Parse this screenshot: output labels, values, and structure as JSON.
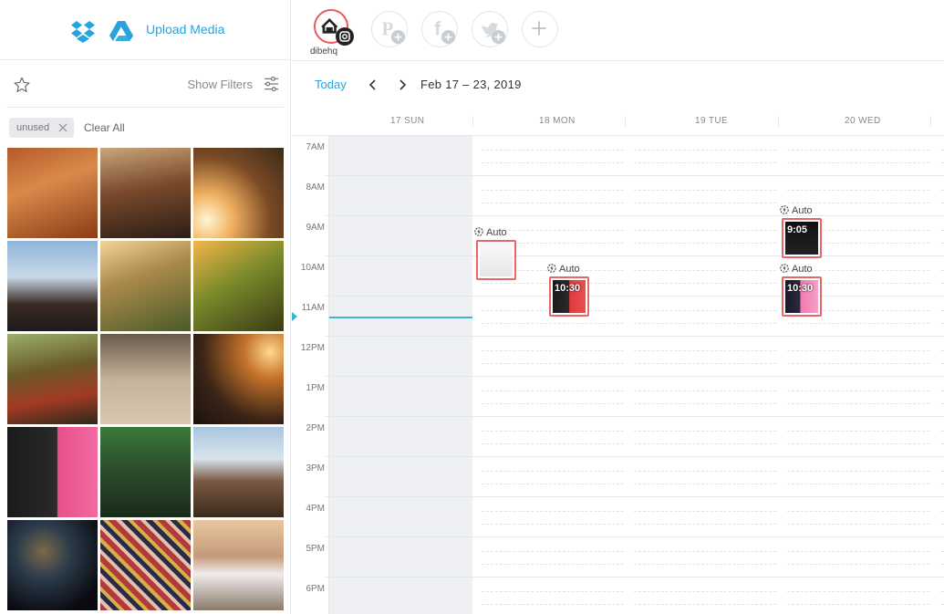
{
  "left_panel": {
    "upload_label": "Upload Media",
    "show_filters_label": "Show Filters",
    "tag_label": "unused",
    "clear_all_label": "Clear All",
    "services": [
      "dropbox-icon",
      "google-drive-icon"
    ],
    "thumbs": [
      {
        "bg": "linear-gradient(160deg,#b45a2a 0%,#d98a4a 40%,#8a3c16 100%)"
      },
      {
        "bg": "linear-gradient(170deg,#caa67a 0%,#7a4a2c 45%,#2b1e16 100%)"
      },
      {
        "bg": "radial-gradient(circle at 15% 80%,#fff6d0 0%,#f0b060 25%,#7a4a24 60%,#3a2a1a 100%)"
      },
      {
        "bg": "linear-gradient(180deg,#8fb4d8 0%,#c8d8e8 40%,#3a2a22 70%,#1d1a1a 100%)"
      },
      {
        "bg": "linear-gradient(160deg,#f4d49a 0%,#a98a4a 40%,#4a5a2a 100%)"
      },
      {
        "bg": "linear-gradient(150deg,#f5b54a 0%,#7a8a2a 45%,#3a3a16 100%)"
      },
      {
        "bg": "linear-gradient(170deg,#9ab06a 0%,#6a5a2a 40%,#a23a24 70%,#2a2a1a 100%)"
      },
      {
        "bg": "linear-gradient(180deg,#6a5a4a 0%,#c4b29a 50%,#d9c8b0 100%)"
      },
      {
        "bg": "radial-gradient(circle at 85% 20%,#ffd890 0%,#c4722a 25%,#3a2416 65%,#1a120e 100%)"
      },
      {
        "bg": "linear-gradient(90deg,#1a1a1a 0%,#2a2a2a 55%,#e8508a 56%,#f06aa0 100%)"
      },
      {
        "bg": "linear-gradient(180deg,#3a7a3a 0%,#2a4a2a 50%,#1a2a1a 100%)"
      },
      {
        "bg": "linear-gradient(180deg,#a9c5de 0%,#d8e4ec 35%,#7a5a44 60%,#3a2a1a 100%)"
      },
      {
        "bg": "radial-gradient(circle at 40% 35%,#7a6a4a 0%,#2a3a4a 35%,#0a0a10 80%)"
      },
      {
        "bg": "repeating-linear-gradient(45deg,#b23a3a 0 6px,#e0c0b0 6px 10px,#2a2a44 10px 15px,#d8b04a 15px 19px)"
      },
      {
        "bg": "linear-gradient(180deg,#e8c8a0 0%,#c49a7a 40%,#f0ecec 60%,#8a7a6a 100%)"
      }
    ]
  },
  "accounts": {
    "active_name": "dibehq",
    "ghosts": [
      "pinterest-add-icon",
      "facebook-add-icon",
      "twitter-add-icon",
      "add-account-icon"
    ]
  },
  "nav": {
    "today_label": "Today",
    "range_label": "Feb 17 – 23, 2019"
  },
  "days": [
    "17 SUN",
    "18 MON",
    "19 TUE",
    "20 WED"
  ],
  "hours": [
    "7AM",
    "8AM",
    "9AM",
    "10AM",
    "11AM",
    "12PM",
    "1PM",
    "2PM",
    "3PM",
    "4PM",
    "5PM",
    "6PM"
  ],
  "posts": [
    {
      "label": "Auto",
      "time_text": "",
      "bg": "linear-gradient(180deg,#fafafa 0%,#e6e6e6 100%)"
    },
    {
      "label": "Auto",
      "time_text": "10:30",
      "bg": "linear-gradient(90deg,#1a1a1a 0%,#2a2a2a 50%,#e03a3a 51%,#e85050 100%)"
    },
    {
      "label": "Auto",
      "time_text": "9:05",
      "bg": "linear-gradient(180deg,#111 0%,#222 100%)"
    },
    {
      "label": "Auto",
      "time_text": "10:30",
      "bg": "linear-gradient(90deg,#1a1a2a 0%,#2a2a3a 45%,#f07ab0 46%,#f4a0c8 100%)"
    }
  ],
  "colors": {
    "accent": "#27a3de",
    "now_line": "#3ab5d8",
    "post_border": "#e76767",
    "instagram_ring": "#ea5a5a"
  }
}
